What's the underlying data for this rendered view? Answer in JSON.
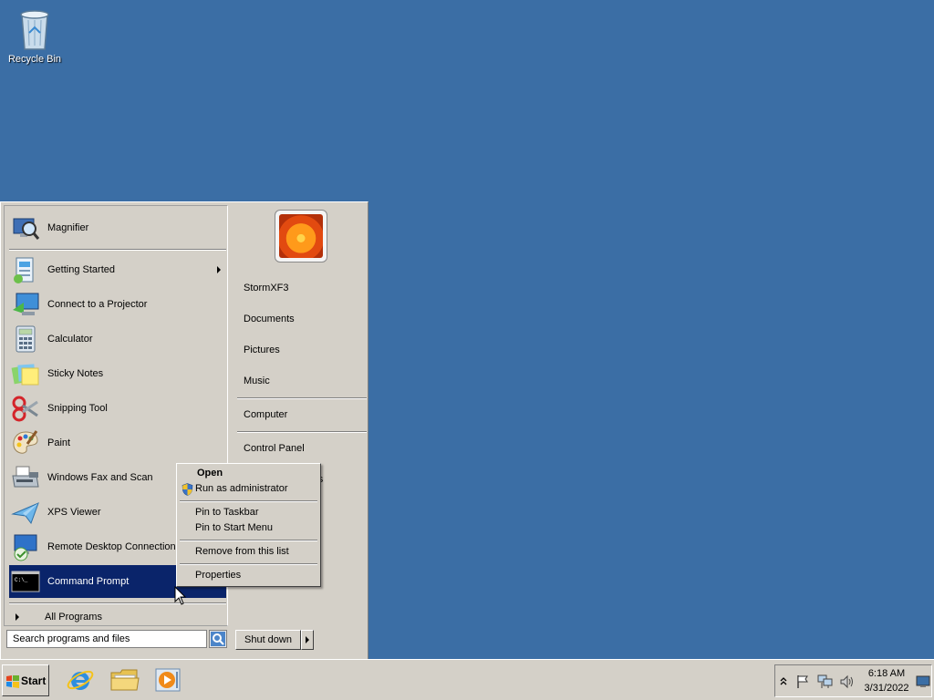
{
  "desktop": {
    "background_color": "#3b6ea5",
    "icons": [
      {
        "label": "Recycle Bin",
        "icon": "recycle-bin-icon"
      }
    ]
  },
  "start_menu": {
    "pinned": [
      {
        "label": "Magnifier",
        "icon": "magnifier-icon"
      }
    ],
    "recent": [
      {
        "label": "Getting Started",
        "icon": "getting-started-icon",
        "has_submenu": true
      },
      {
        "label": "Connect to a Projector",
        "icon": "projector-icon"
      },
      {
        "label": "Calculator",
        "icon": "calculator-icon"
      },
      {
        "label": "Sticky Notes",
        "icon": "sticky-notes-icon"
      },
      {
        "label": "Snipping Tool",
        "icon": "scissors-icon"
      },
      {
        "label": "Paint",
        "icon": "paint-palette-icon"
      },
      {
        "label": "Windows Fax and Scan",
        "icon": "fax-icon"
      },
      {
        "label": "XPS Viewer",
        "icon": "xps-viewer-icon"
      },
      {
        "label": "Remote Desktop Connection",
        "icon": "remote-desktop-icon"
      },
      {
        "label": "Command Prompt",
        "icon": "command-prompt-icon",
        "selected": true
      }
    ],
    "all_programs": "All Programs",
    "search_placeholder": "Search programs and files",
    "right_pane": {
      "user_name": "StormXF3",
      "group1": [
        "Documents",
        "Pictures",
        "Music"
      ],
      "group2": [
        "Computer"
      ],
      "group3": [
        "Control Panel"
      ],
      "partial_hidden_text": "ers"
    },
    "shutdown_label": "Shut down"
  },
  "context_menu": {
    "items": [
      {
        "label": "Open",
        "bold": true
      },
      {
        "label": "Run as administrator",
        "icon": "uac-shield-icon"
      },
      {
        "label": "Pin to Taskbar"
      },
      {
        "label": "Pin to Start Menu"
      },
      {
        "label": "Remove from this list"
      },
      {
        "label": "Properties"
      }
    ]
  },
  "taskbar": {
    "start_label": "Start",
    "pinned": [
      {
        "name": "Internet Explorer",
        "icon": "internet-explorer-icon"
      },
      {
        "name": "Windows Explorer",
        "icon": "folder-icon"
      },
      {
        "name": "Windows Media Player",
        "icon": "media-player-icon"
      }
    ],
    "tray": {
      "icons": [
        "show-hidden-icons-chevron",
        "action-center-flag-icon",
        "network-icon",
        "volume-icon"
      ],
      "time": "6:18 AM",
      "date": "3/31/2022"
    }
  }
}
